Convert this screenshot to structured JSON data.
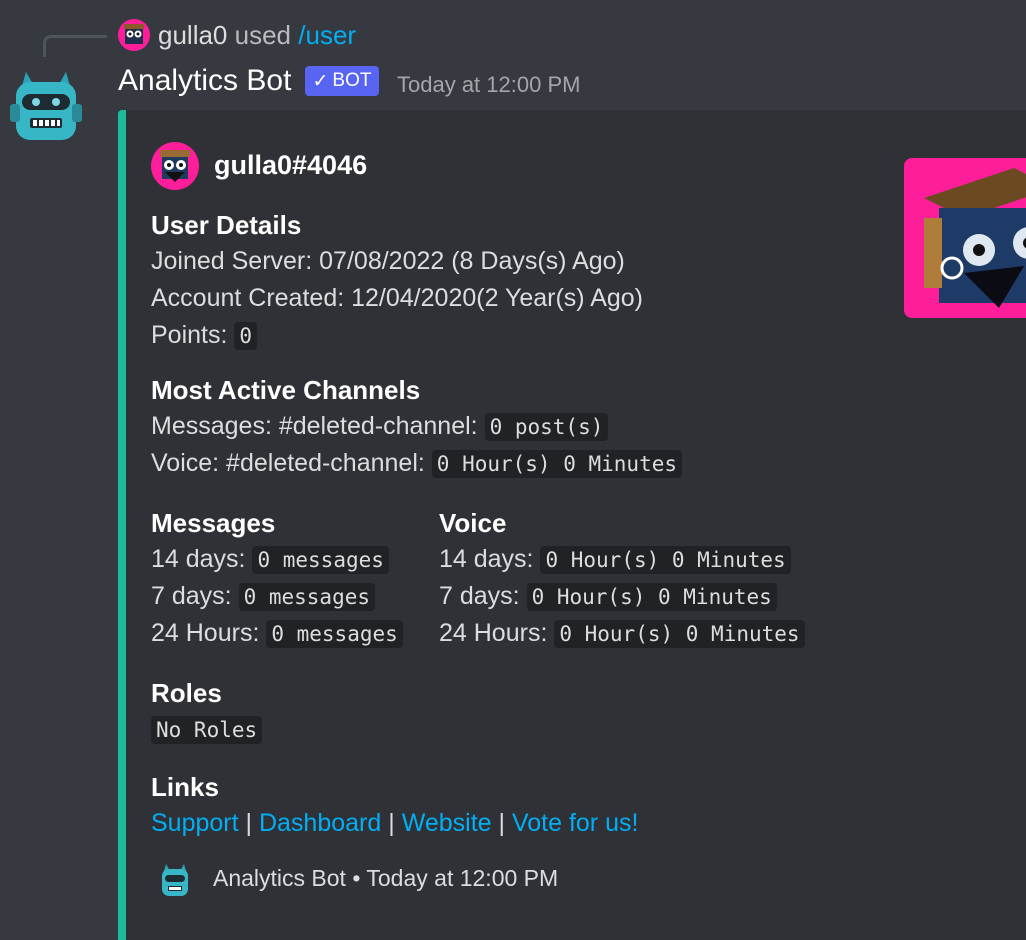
{
  "reply": {
    "username": "gulla0",
    "used_text": "used",
    "command": "/user"
  },
  "message": {
    "author": "Analytics Bot",
    "tag": "BOT",
    "tag_check": "✓",
    "timestamp": "Today at 12:00 PM"
  },
  "embed": {
    "accent_color": "#1abc9c",
    "author": "gulla0#4046",
    "user_details": {
      "title": "User Details",
      "joined_label": "Joined Server:",
      "joined_value": "07/08/2022 (8 Days(s) Ago)",
      "created_label": "Account Created:",
      "created_value": "12/04/2020(2 Year(s) Ago)",
      "points_label": "Points:",
      "points_value": "0"
    },
    "most_active": {
      "title": "Most Active Channels",
      "messages_label": "Messages: #deleted-channel:",
      "messages_value": "0 post(s)",
      "voice_label": "Voice: #deleted-channel:",
      "voice_value": "0 Hour(s) 0 Minutes"
    },
    "messages": {
      "title": "Messages",
      "rows": [
        {
          "label": "14 days:",
          "value": "0 messages"
        },
        {
          "label": "7 days:",
          "value": "0 messages"
        },
        {
          "label": "24 Hours:",
          "value": "0 messages"
        }
      ]
    },
    "voice": {
      "title": "Voice",
      "rows": [
        {
          "label": "14 days:",
          "value": "0 Hour(s) 0 Minutes"
        },
        {
          "label": "7 days:",
          "value": "0 Hour(s) 0 Minutes"
        },
        {
          "label": "24 Hours:",
          "value": "0 Hour(s) 0 Minutes"
        }
      ]
    },
    "roles": {
      "title": "Roles",
      "value": "No Roles"
    },
    "links": {
      "title": "Links",
      "separator": "|",
      "items": [
        "Support",
        "Dashboard",
        "Website",
        "Vote for us!"
      ]
    },
    "footer": {
      "text": "Analytics Bot",
      "dot": "•",
      "timestamp": "Today at 12:00 PM"
    }
  },
  "colors": {
    "background": "#36393f",
    "embed_bg": "#2f3136",
    "link": "#00aff4",
    "bot_tag": "#5865f2"
  }
}
